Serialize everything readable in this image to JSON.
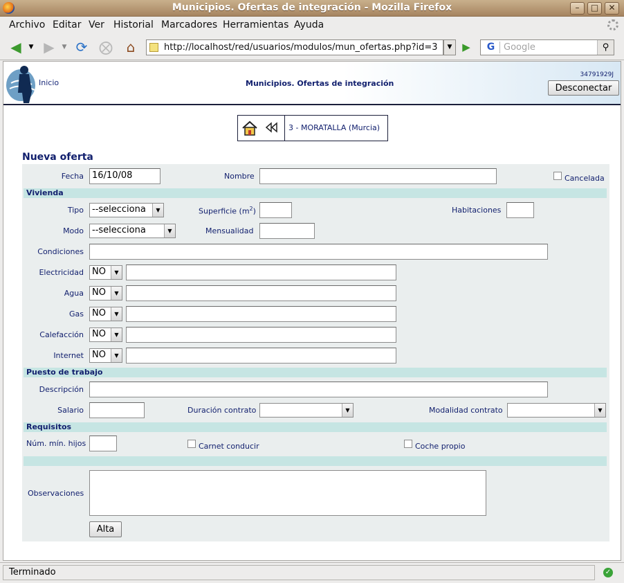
{
  "window": {
    "title": "Municipios. Ofertas de integración - Mozilla Firefox"
  },
  "menu": {
    "items": [
      "Archivo",
      "Editar",
      "Ver",
      "Historial",
      "Marcadores",
      "Herramientas",
      "Ayuda"
    ]
  },
  "nav": {
    "url": "http://localhost/red/usuarios/modulos/mun_ofertas.php?id=3",
    "search_placeholder": "Google"
  },
  "header": {
    "inicio": "Inicio",
    "title": "Municipios. Ofertas de integración",
    "user_id": "34791929J",
    "logout": "Desconectar"
  },
  "breadcrumb": {
    "municipio": "3 - MORATALLA (Murcia)"
  },
  "form": {
    "title": "Nueva oferta",
    "fecha_label": "Fecha",
    "fecha_value": "16/10/08",
    "nombre_label": "Nombre",
    "cancelada_label": "Cancelada",
    "vivienda": {
      "section": "Vivienda",
      "tipo_label": "Tipo",
      "tipo_value": "--selecciona",
      "superficie_label": "Superficie (m",
      "superficie_sup": "2",
      "superficie_close": ")",
      "habitaciones_label": "Habitaciones",
      "modo_label": "Modo",
      "modo_value": "--selecciona",
      "mensualidad_label": "Mensualidad",
      "condiciones_label": "Condiciones",
      "servicios": [
        {
          "label": "Electricidad",
          "value": "NO"
        },
        {
          "label": "Agua",
          "value": "NO"
        },
        {
          "label": "Gas",
          "value": "NO"
        },
        {
          "label": "Calefacción",
          "value": "NO"
        },
        {
          "label": "Internet",
          "value": "NO"
        }
      ]
    },
    "trabajo": {
      "section": "Puesto de trabajo",
      "descripcion_label": "Descripción",
      "salario_label": "Salario",
      "duracion_label": "Duración contrato",
      "modalidad_label": "Modalidad contrato"
    },
    "requisitos": {
      "section": "Requisitos",
      "hijos_label": "Núm. mín. hijos",
      "carnet_label": "Carnet conducir",
      "coche_label": "Coche propio"
    },
    "observaciones_label": "Observaciones",
    "submit": "Alta"
  },
  "status": {
    "text": "Terminado"
  }
}
